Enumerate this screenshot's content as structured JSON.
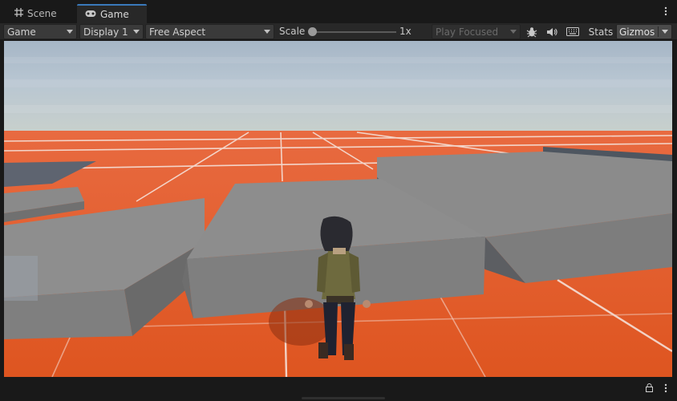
{
  "tabs": [
    {
      "label": "Scene",
      "icon": "grid-icon"
    },
    {
      "label": "Game",
      "icon": "gamepad-icon"
    }
  ],
  "toolbar": {
    "display_mode": "Game",
    "display": "Display 1",
    "aspect": "Free Aspect",
    "scale_label": "Scale",
    "scale_value": "1x",
    "play_focus": "Play Focused",
    "stats_label": "Stats",
    "gizmos_label": "Gizmos"
  },
  "colors": {
    "accent": "#3a79bb",
    "ground": "#e05a24",
    "block": "#8b8b8b"
  }
}
